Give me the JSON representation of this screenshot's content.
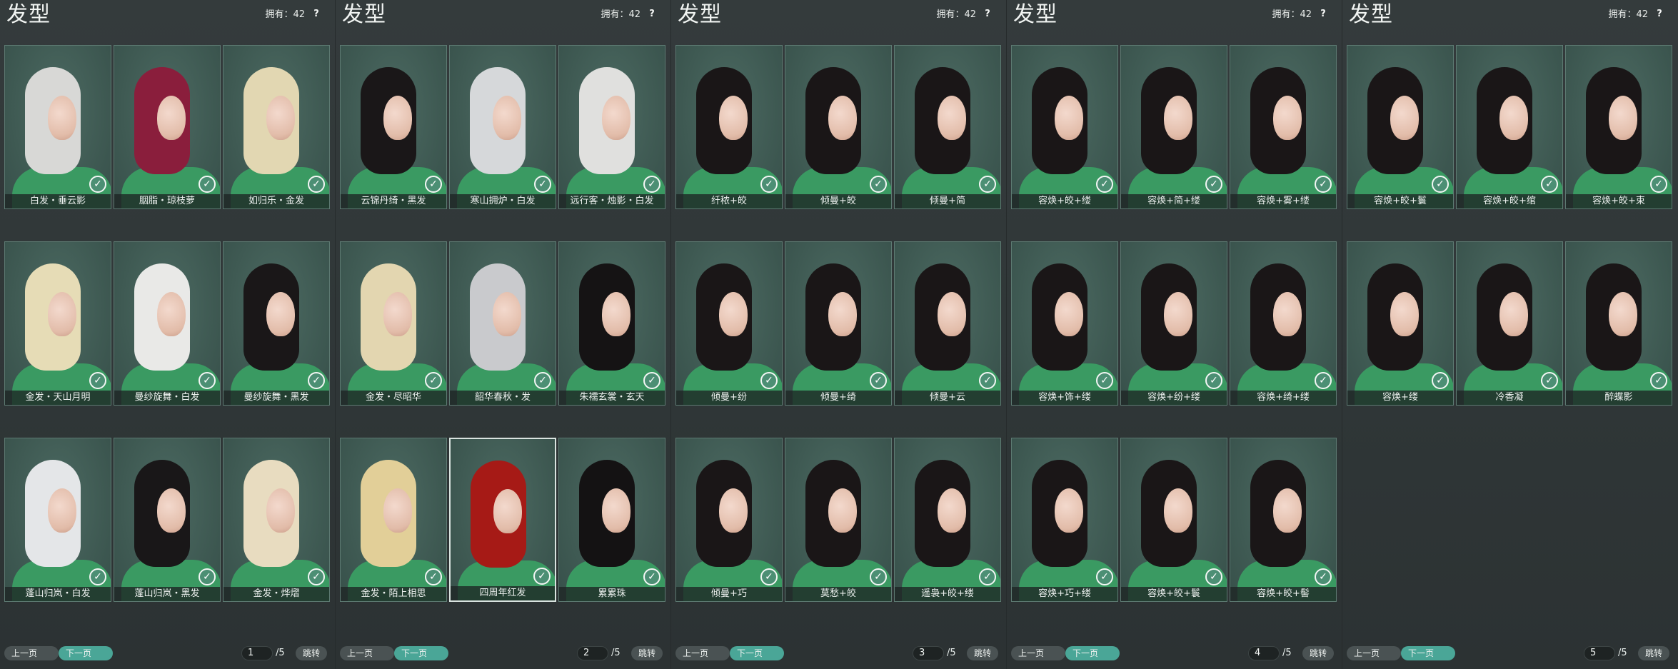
{
  "common": {
    "title": "发型",
    "owned_label": "拥有：42",
    "help": "?",
    "prev_label": "上一页",
    "next_label": "下一页",
    "total_pages": "/5",
    "jump_label": "跳转",
    "check_glyph": "✓"
  },
  "colors": {
    "card_bg": "#415c55",
    "label_bg": "#1e2424",
    "accent_button": "#4aa697",
    "robe_green": "#3a9a62"
  },
  "pages": [
    {
      "page_number": "1",
      "cards": [
        {
          "label": "白发・垂云影",
          "hair": "#d8d8d6"
        },
        {
          "label": "胭脂・琼枝萝",
          "hair": "#8a1e3c"
        },
        {
          "label": "如归乐・金发",
          "hair": "#e2d7b2"
        },
        {
          "label": "金发・天山月明",
          "hair": "#e6dcb6"
        },
        {
          "label": "曼纱旋舞・白发",
          "hair": "#e9e9e7"
        },
        {
          "label": "曼纱旋舞・黑发",
          "hair": "#1a1718"
        },
        {
          "label": "蓬山归岚・白发",
          "hair": "#e4e6e8"
        },
        {
          "label": "蓬山归岚・黑发",
          "hair": "#191718"
        },
        {
          "label": "金发・烨熠",
          "hair": "#e8dcc0"
        }
      ]
    },
    {
      "page_number": "2",
      "cards": [
        {
          "label": "云锦丹绮・黑发",
          "hair": "#1a1718"
        },
        {
          "label": "寒山拥炉・白发",
          "hair": "#d6d8da"
        },
        {
          "label": "远行客・烛影・白发",
          "hair": "#e0e0de"
        },
        {
          "label": "金发・尽昭华",
          "hair": "#e3d6b0"
        },
        {
          "label": "韶华春秋・发",
          "hair": "#c9cacd"
        },
        {
          "label": "朱襦玄裳・玄天",
          "hair": "#151314"
        },
        {
          "label": "金发・陌上相思",
          "hair": "#e2cf98"
        },
        {
          "label": "四周年红发",
          "hair": "#a61a16",
          "selected": true
        },
        {
          "label": "累累珠",
          "hair": "#141213"
        }
      ]
    },
    {
      "page_number": "3",
      "cards": [
        {
          "label": "纤秾+皎",
          "hair": "#1a1617"
        },
        {
          "label": "倾曼+皎",
          "hair": "#1a1617"
        },
        {
          "label": "倾曼+简",
          "hair": "#1a1617"
        },
        {
          "label": "倾曼+纷",
          "hair": "#1a1617"
        },
        {
          "label": "倾曼+绮",
          "hair": "#1a1617"
        },
        {
          "label": "倾曼+云",
          "hair": "#1a1617"
        },
        {
          "label": "倾曼+巧",
          "hair": "#1a1617"
        },
        {
          "label": "莫愁+皎",
          "hair": "#1a1617"
        },
        {
          "label": "遥袅+皎+缕",
          "hair": "#1a1617"
        }
      ]
    },
    {
      "page_number": "4",
      "cards": [
        {
          "label": "容焕+皎+缕",
          "hair": "#1a1617"
        },
        {
          "label": "容焕+简+缕",
          "hair": "#1a1617"
        },
        {
          "label": "容焕+雾+缕",
          "hair": "#1a1617"
        },
        {
          "label": "容焕+饰+缕",
          "hair": "#1a1617"
        },
        {
          "label": "容焕+纷+缕",
          "hair": "#1a1617"
        },
        {
          "label": "容焕+绮+缕",
          "hair": "#1a1617"
        },
        {
          "label": "容焕+巧+缕",
          "hair": "#1a1617"
        },
        {
          "label": "容焕+皎+鬟",
          "hair": "#1a1617"
        },
        {
          "label": "容焕+皎+髻",
          "hair": "#1a1617"
        }
      ]
    },
    {
      "page_number": "5",
      "cards": [
        {
          "label": "容焕+皎+鬟",
          "hair": "#1a1617"
        },
        {
          "label": "容焕+皎+绾",
          "hair": "#1a1617"
        },
        {
          "label": "容焕+皎+束",
          "hair": "#1a1617"
        },
        {
          "label": "容焕+缕",
          "hair": "#1a1617"
        },
        {
          "label": "冷香凝",
          "hair": "#1a1617"
        },
        {
          "label": "醉蝶影",
          "hair": "#1a1617"
        }
      ]
    }
  ]
}
